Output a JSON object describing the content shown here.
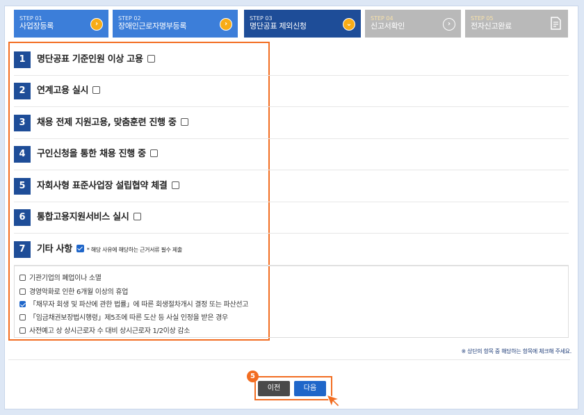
{
  "steps": [
    {
      "num": "STEP 01",
      "label": "사업장등록",
      "state": "done",
      "icon": "chevron-right-icon"
    },
    {
      "num": "STEP 02",
      "label": "장애인근로자명부등록",
      "state": "done",
      "icon": "chevron-right-icon"
    },
    {
      "num": "STEP 03",
      "label": "명단공표 제외신청",
      "state": "current",
      "icon": "chevron-down-icon"
    },
    {
      "num": "STEP 04",
      "label": "신고서확인",
      "state": "todo",
      "icon": "chevron-right-icon"
    },
    {
      "num": "STEP 05",
      "label": "전자신고완료",
      "state": "todo",
      "icon": "document-icon"
    }
  ],
  "items": [
    {
      "num": "1",
      "label": "명단공표 기준인원 이상 고용",
      "checked": false
    },
    {
      "num": "2",
      "label": "연계고용 실시",
      "checked": false
    },
    {
      "num": "3",
      "label": "채용 전제 지원고용, 맞춤훈련 진행 중",
      "checked": false
    },
    {
      "num": "4",
      "label": "구인신청을 통한 채용 진행 중",
      "checked": false
    },
    {
      "num": "5",
      "label": "자회사형 표준사업장 설립협약 체결",
      "checked": false
    },
    {
      "num": "6",
      "label": "통합고용지원서비스 실시",
      "checked": false
    },
    {
      "num": "7",
      "label": "기타 사항",
      "checked": true,
      "note": "* 해당 사유에 해당하는 근거서류 필수 제출"
    }
  ],
  "sub_options": [
    {
      "label": "기관기업의 폐업이나 소멸",
      "checked": false
    },
    {
      "label": "경영악화로 인한 6개월 이상의 휴업",
      "checked": false
    },
    {
      "label": "「채무자 회생 및 파산에 관한 법률」에 따른 회생절차개시 결정 또는 파산선고",
      "checked": true
    },
    {
      "label": "「임금채권보장법시행령」제5조에 따른 도산 등 사실 인정을 받은 경우",
      "checked": false
    },
    {
      "label": "사전예고 상 상시근로자 수 대비 상시근로자 1/2이상 감소",
      "checked": false
    }
  ],
  "hint": "※ 상단의 항목 중 해당하는 항목에 체크해 주세요.",
  "buttons": {
    "prev": "이전",
    "next": "다음"
  },
  "badge": "5"
}
